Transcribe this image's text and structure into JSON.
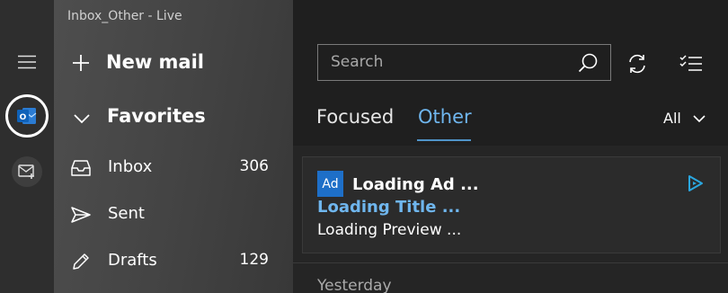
{
  "window": {
    "title": "Inbox_Other - Live"
  },
  "nav": {
    "new_mail_label": "New mail",
    "favorites_label": "Favorites",
    "folders": [
      {
        "label": "Inbox",
        "count": "306",
        "icon": "inbox-icon"
      },
      {
        "label": "Sent",
        "count": "",
        "icon": "send-icon"
      },
      {
        "label": "Drafts",
        "count": "129",
        "icon": "pencil-icon"
      }
    ]
  },
  "rail": {
    "account_badge": "O",
    "icons": [
      "hamburger-menu-icon",
      "outlook-account-icon",
      "add-account-icon"
    ]
  },
  "main": {
    "search": {
      "placeholder": "Search",
      "value": ""
    },
    "tabs": [
      {
        "label": "Focused",
        "selected": false
      },
      {
        "label": "Other",
        "selected": true
      }
    ],
    "filter_label": "All",
    "ad": {
      "badge": "Ad",
      "heading": "Loading Ad ...",
      "title": "Loading Title ...",
      "preview": "Loading Preview ..."
    },
    "group_header": "Yesterday"
  },
  "colors": {
    "accent": "#6fb6ee",
    "ad_badge": "#1e6fc8",
    "rail_bg": "#2e2e2e",
    "nav_bg": "#4e4e4e",
    "main_bg": "#1f1f1f"
  }
}
